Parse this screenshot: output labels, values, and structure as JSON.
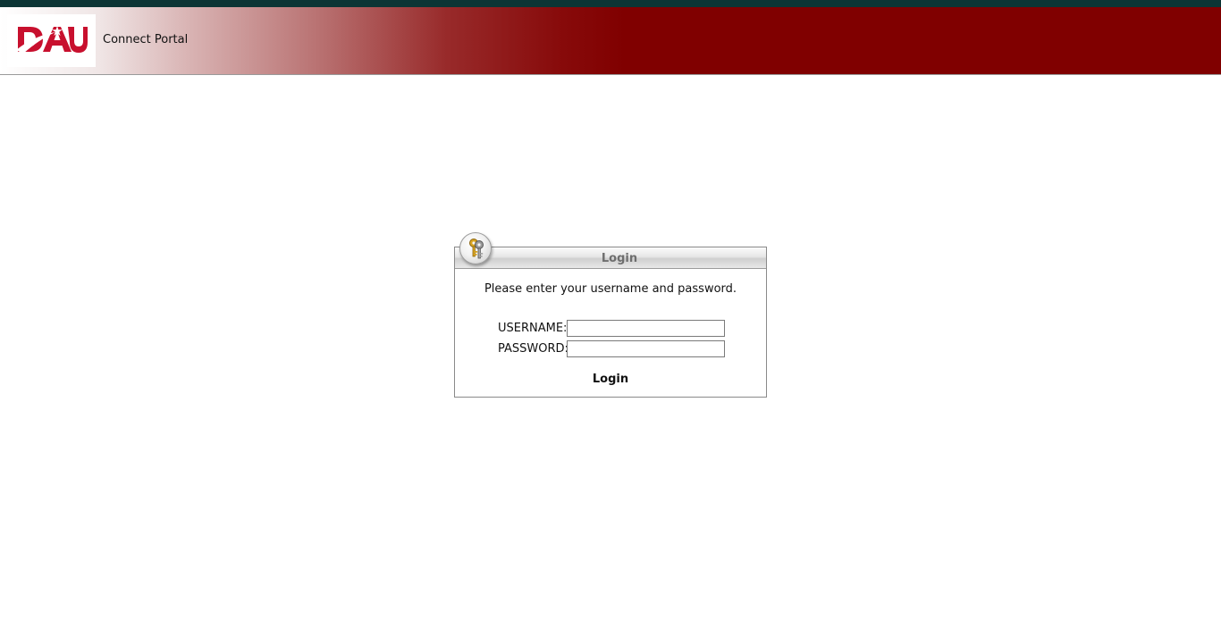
{
  "app": {
    "title": "Connect Portal",
    "logo_text": "DAU"
  },
  "login": {
    "panel_title": "Login",
    "prompt": "Please enter your username and password.",
    "username_label": "USERNAME:",
    "password_label": "PASSWORD:",
    "username_value": "",
    "password_value": "",
    "submit_label": "Login",
    "icon": "keys-icon"
  },
  "colors": {
    "banner": "#800000",
    "top_strip": "#0c3535",
    "logo_red": "#c8102e"
  }
}
